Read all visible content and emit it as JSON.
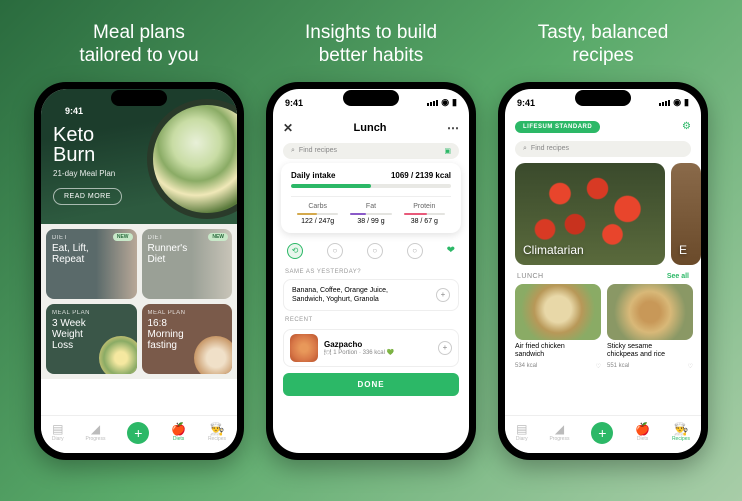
{
  "status_time": "9:41",
  "phone1": {
    "headline": "Meal plans\ntailored to you",
    "hero_title": "Keto\nBurn",
    "hero_subtitle": "21-day Meal Plan",
    "hero_btn": "READ MORE",
    "cards": [
      {
        "label": "DIET",
        "title": "Eat, Lift,\nRepeat",
        "badge": "NEW"
      },
      {
        "label": "DIET",
        "title": "Runner's\nDiet",
        "badge": "NEW"
      },
      {
        "label": "MEAL PLAN",
        "title": "3 Week\nWeight\nLoss"
      },
      {
        "label": "MEAL PLAN",
        "title": "16:8\nMorning\nfasting"
      }
    ],
    "nav": [
      "Diary",
      "Progress",
      "",
      "Diets",
      "Recipes"
    ]
  },
  "phone2": {
    "headline": "Insights to build\nbetter habits",
    "title": "Lunch",
    "search_placeholder": "Find recipes",
    "intake_label": "Daily intake",
    "intake_val": "1069 / 2139 kcal",
    "macros": [
      {
        "name": "Carbs",
        "val": "122 / 247g"
      },
      {
        "name": "Fat",
        "val": "38 / 99 g"
      },
      {
        "name": "Protein",
        "val": "38 / 67 g"
      }
    ],
    "yest_label": "SAME AS YESTERDAY?",
    "yest_text": "Banana, Coffee, Orange Juice,\nSandwich, Yoghurt, Granola",
    "recent_label": "RECENT",
    "recent_name": "Gazpacho",
    "recent_meta": "🍽 1 Portion · 336 kcal 💚",
    "done": "DONE"
  },
  "phone3": {
    "headline": "Tasty, balanced\nrecipes",
    "chip": "LIFESUM STANDARD",
    "search_placeholder": "Find recipes",
    "featured_title": "Climatarian",
    "featured_partial": "E",
    "section_label": "LUNCH",
    "see_all": "See all",
    "recipes": [
      {
        "name": "Air fried chicken\nsandwich",
        "kcal": "534 kcal"
      },
      {
        "name": "Sticky sesame\nchickpeas and rice",
        "kcal": "551 kcal"
      }
    ],
    "nav": [
      "Diary",
      "Progress",
      "",
      "Diets",
      "Recipes"
    ]
  }
}
